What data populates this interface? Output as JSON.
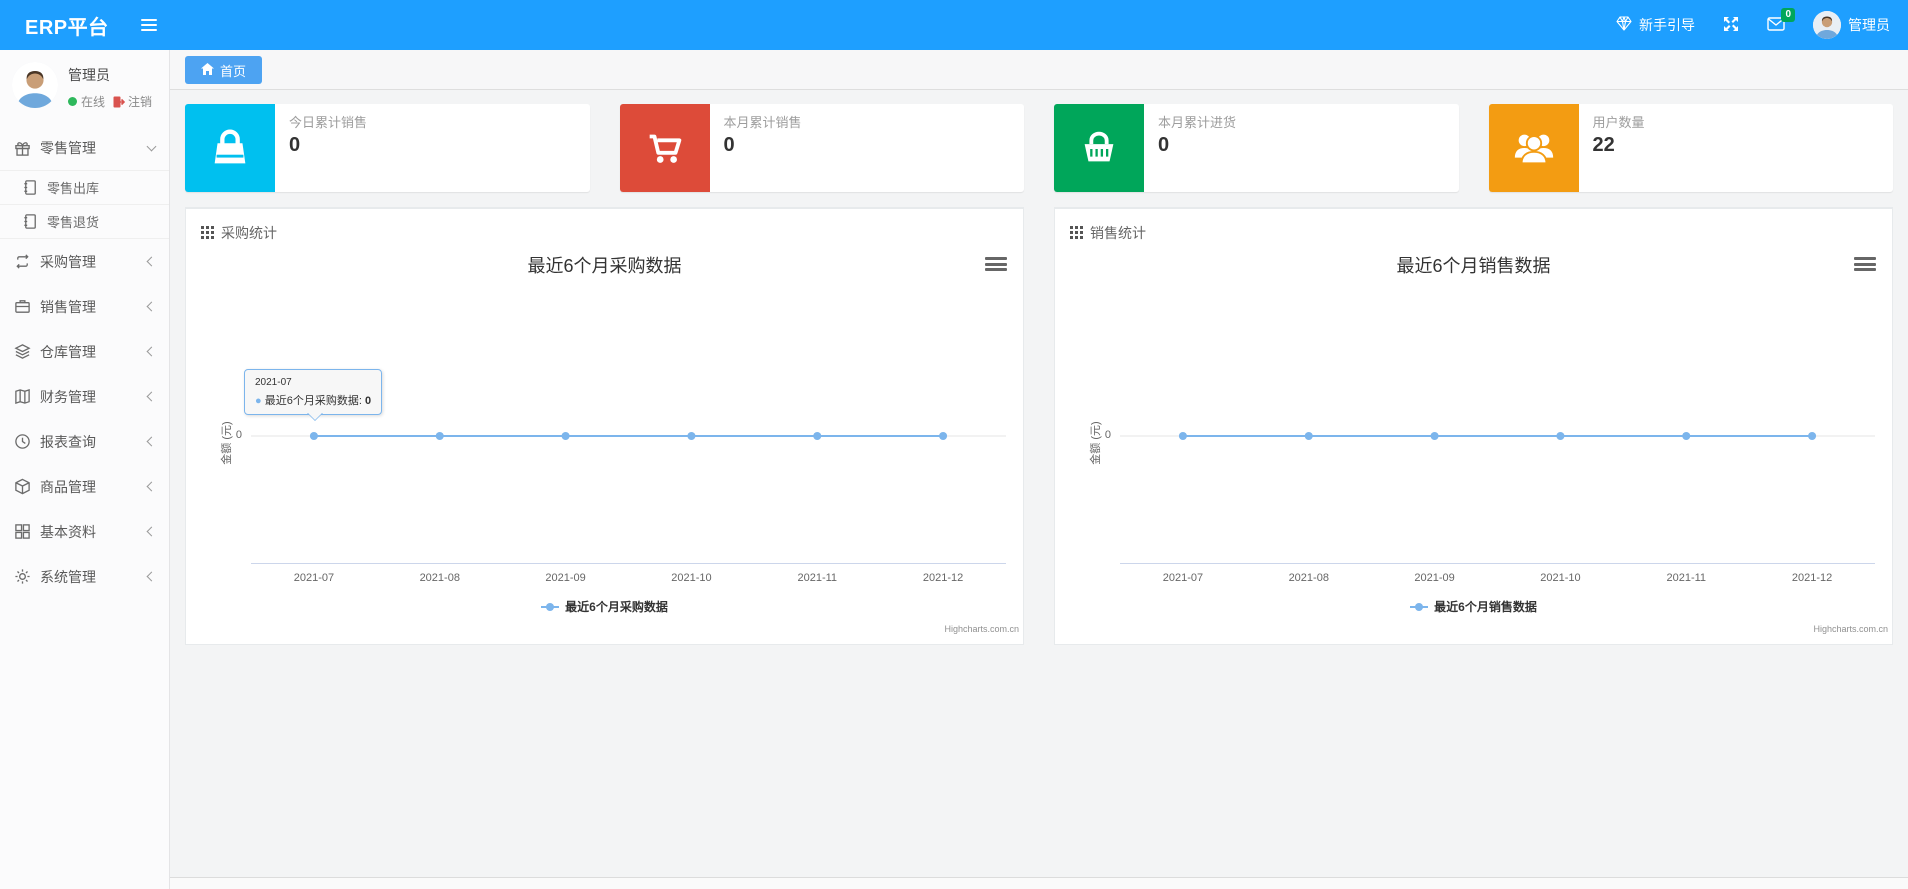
{
  "navbar": {
    "brand": "ERP平台",
    "guide": "新手引导",
    "mail_badge": "0",
    "user": "管理员"
  },
  "sidebar": {
    "profile": {
      "name": "管理员",
      "status": "在线",
      "logout": "注销"
    },
    "menu": [
      {
        "label": "零售管理",
        "icon": "gift-icon",
        "expanded": true,
        "children": [
          {
            "label": "零售出库",
            "icon": "journal-icon"
          },
          {
            "label": "零售退货",
            "icon": "journal-icon"
          }
        ]
      },
      {
        "label": "采购管理",
        "icon": "repeat-icon"
      },
      {
        "label": "销售管理",
        "icon": "briefcase-icon"
      },
      {
        "label": "仓库管理",
        "icon": "layers-icon"
      },
      {
        "label": "财务管理",
        "icon": "open-book-icon"
      },
      {
        "label": "报表查询",
        "icon": "clock-icon"
      },
      {
        "label": "商品管理",
        "icon": "cube-icon"
      },
      {
        "label": "基本资料",
        "icon": "grid-icon"
      },
      {
        "label": "系统管理",
        "icon": "gear-icon"
      }
    ]
  },
  "tabs": {
    "home": "首页"
  },
  "stats": [
    {
      "label": "今日累计销售",
      "value": "0",
      "color": "#00c0ef",
      "icon": "shopping-bag-icon"
    },
    {
      "label": "本月累计销售",
      "value": "0",
      "color": "#dd4b39",
      "icon": "shopping-cart-icon"
    },
    {
      "label": "本月累计进货",
      "value": "0",
      "color": "#00a65a",
      "icon": "shopping-basket-icon"
    },
    {
      "label": "用户数量",
      "value": "22",
      "color": "#f39c12",
      "icon": "users-icon"
    }
  ],
  "panels": [
    {
      "header": "采购统计"
    },
    {
      "header": "销售统计"
    }
  ],
  "chart_data": [
    {
      "type": "line",
      "title": "最近6个月采购数据",
      "categories": [
        "2021-07",
        "2021-08",
        "2021-09",
        "2021-10",
        "2021-11",
        "2021-12"
      ],
      "series": [
        {
          "name": "最近6个月采购数据",
          "values": [
            0,
            0,
            0,
            0,
            0,
            0
          ]
        }
      ],
      "xlabel": "",
      "ylabel": "金额 (元)",
      "yticks": [
        "0"
      ],
      "ylim": [
        0,
        null
      ],
      "grid": true,
      "legend_position": "bottom",
      "line_color": "#7cb5ec",
      "grid_color": "#e6e6e6",
      "axis_color": "#ccd6eb",
      "credits": "Highcharts.com.cn"
    },
    {
      "type": "line",
      "title": "最近6个月销售数据",
      "categories": [
        "2021-07",
        "2021-08",
        "2021-09",
        "2021-10",
        "2021-11",
        "2021-12"
      ],
      "series": [
        {
          "name": "最近6个月销售数据",
          "values": [
            0,
            0,
            0,
            0,
            0,
            0
          ]
        }
      ],
      "xlabel": "",
      "ylabel": "金额 (元)",
      "yticks": [
        "0"
      ],
      "ylim": [
        0,
        null
      ],
      "grid": true,
      "legend_position": "bottom",
      "line_color": "#7cb5ec",
      "grid_color": "#e6e6e6",
      "axis_color": "#ccd6eb",
      "credits": "Highcharts.com.cn"
    }
  ],
  "tooltip": {
    "header": "2021-07",
    "series_label": "最近6个月采购数据:",
    "value": "0"
  }
}
